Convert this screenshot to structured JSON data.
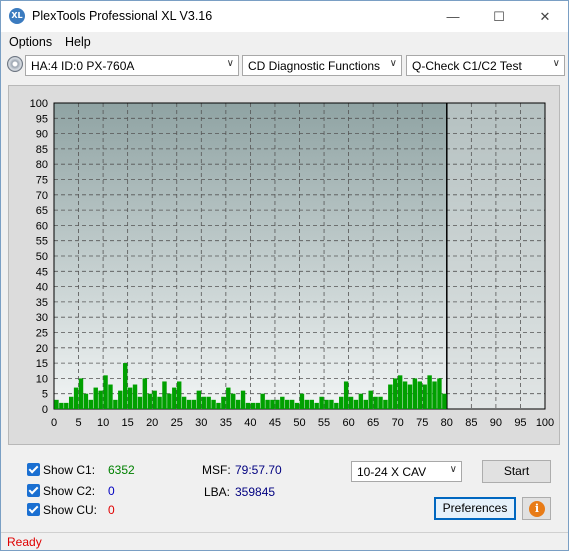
{
  "window": {
    "title": "PlexTools Professional XL V3.16",
    "icon_text": "XL"
  },
  "menu": {
    "options": "Options",
    "help": "Help"
  },
  "toolbar": {
    "drive": "HA:4 ID:0  PX-760A",
    "function": "CD Diagnostic Functions",
    "test": "Q-Check C1/C2 Test"
  },
  "chart_data": {
    "type": "bar",
    "title": "",
    "xlabel": "",
    "ylabel": "",
    "xlim": [
      0,
      100
    ],
    "ylim": [
      0,
      100
    ],
    "x_ticks": [
      0,
      5,
      10,
      15,
      20,
      25,
      30,
      35,
      40,
      45,
      50,
      55,
      60,
      65,
      70,
      75,
      80,
      85,
      90,
      95,
      100
    ],
    "y_ticks": [
      0,
      5,
      10,
      15,
      20,
      25,
      30,
      35,
      40,
      45,
      50,
      55,
      60,
      65,
      70,
      75,
      80,
      85,
      90,
      95,
      100
    ],
    "grid": true,
    "end_marker_x": 80,
    "series": [
      {
        "color": "#00a000",
        "x": [
          0.5,
          1.5,
          2.5,
          3.5,
          4.5,
          5.5,
          6.5,
          7.5,
          8.5,
          9.5,
          10.5,
          11.5,
          12.5,
          13.5,
          14.5,
          15.5,
          16.5,
          17.5,
          18.5,
          19.5,
          20.5,
          21.5,
          22.5,
          23.5,
          24.5,
          25.5,
          26.5,
          27.5,
          28.5,
          29.5,
          30.5,
          31.5,
          32.5,
          33.5,
          34.5,
          35.5,
          36.5,
          37.5,
          38.5,
          39.5,
          40.5,
          41.5,
          42.5,
          43.5,
          44.5,
          45.5,
          46.5,
          47.5,
          48.5,
          49.5,
          50.5,
          51.5,
          52.5,
          53.5,
          54.5,
          55.5,
          56.5,
          57.5,
          58.5,
          59.5,
          60.5,
          61.5,
          62.5,
          63.5,
          64.5,
          65.5,
          66.5,
          67.5,
          68.5,
          69.5,
          70.5,
          71.5,
          72.5,
          73.5,
          74.5,
          75.5,
          76.5,
          77.5,
          78.5,
          79.5
        ],
        "values": [
          3,
          2,
          2,
          4,
          7,
          10,
          5,
          3,
          7,
          6,
          11,
          8,
          3,
          6,
          15,
          7,
          8,
          4,
          10,
          5,
          6,
          4,
          9,
          5,
          7,
          9,
          4,
          3,
          3,
          6,
          4,
          4,
          3,
          2,
          4,
          7,
          5,
          3,
          6,
          2,
          2,
          2,
          5,
          3,
          3,
          3,
          4,
          3,
          3,
          2,
          5,
          3,
          3,
          2,
          4,
          3,
          3,
          2,
          4,
          9,
          4,
          3,
          5,
          3,
          6,
          4,
          4,
          3,
          8,
          10,
          11,
          9,
          8,
          10,
          9,
          8,
          11,
          9,
          10,
          5
        ]
      }
    ]
  },
  "stats": {
    "c1_label": "Show C1:",
    "c1_value": "6352",
    "c2_label": "Show C2:",
    "c2_value": "0",
    "cu_label": "Show CU:",
    "cu_value": "0",
    "msf_label": "MSF:",
    "msf_value": "79:57.70",
    "lba_label": "LBA:",
    "lba_value": "359845"
  },
  "controls": {
    "speed": "10-24 X CAV",
    "start": "Start",
    "preferences": "Preferences",
    "info_icon_text": "i"
  },
  "status": {
    "text": "Ready"
  }
}
